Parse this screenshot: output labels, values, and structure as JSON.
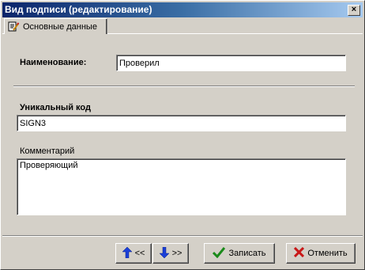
{
  "window": {
    "title": "Вид подписи (редактирование)",
    "close_symbol": "×"
  },
  "tab": {
    "label": "Основные данные",
    "icon": "edit-document-icon"
  },
  "form": {
    "name_label": "Наименование:",
    "name_value": "Проверил",
    "code_label": "Уникальный код",
    "code_value": "SIGN3",
    "comment_label": "Комментарий",
    "comment_value": "Проверяющий"
  },
  "buttons": {
    "prev_label": "<<",
    "next_label": ">>",
    "save_label": "Записать",
    "cancel_label": "Отменить"
  },
  "colors": {
    "title_bar": "#0a246a",
    "arrow_blue": "#1a3fd8",
    "check_green": "#1a8a1a",
    "cross_red": "#c81818"
  }
}
